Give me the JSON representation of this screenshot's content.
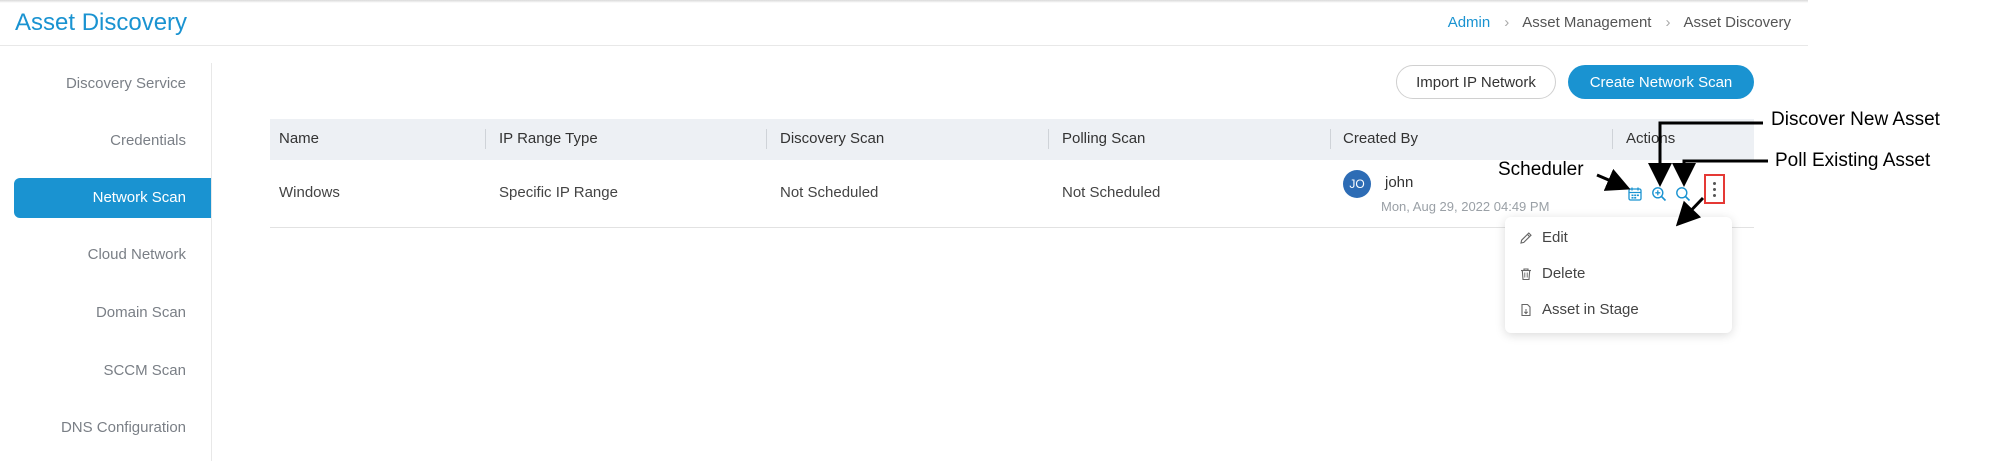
{
  "header": {
    "title": "Asset Discovery",
    "breadcrumb": [
      "Admin",
      "Asset Management",
      "Asset Discovery"
    ]
  },
  "sidebar": {
    "items": [
      {
        "label": "Discovery Service"
      },
      {
        "label": "Credentials"
      },
      {
        "label": "Network Scan"
      },
      {
        "label": "Cloud Network"
      },
      {
        "label": "Domain Scan"
      },
      {
        "label": "SCCM Scan"
      },
      {
        "label": "DNS Configuration"
      }
    ],
    "active": "Network Scan"
  },
  "toolbar": {
    "import_label": "Import IP Network",
    "create_label": "Create Network Scan"
  },
  "table": {
    "columns": [
      "Name",
      "IP Range Type",
      "Discovery Scan",
      "Polling Scan",
      "Created By",
      "Actions"
    ],
    "rows": [
      {
        "name": "Windows",
        "ip_range_type": "Specific IP Range",
        "discovery_scan": "Not Scheduled",
        "polling_scan": "Not Scheduled",
        "avatar_initials": "JO",
        "created_by": "john",
        "created_at": "Mon, Aug 29, 2022 04:49 PM"
      }
    ]
  },
  "row_menu": {
    "items": [
      {
        "label": "Edit",
        "icon": "pencil-icon"
      },
      {
        "label": "Delete",
        "icon": "trash-icon"
      },
      {
        "label": "Asset in Stage",
        "icon": "document-icon"
      }
    ]
  },
  "annotations": {
    "scheduler": "Scheduler",
    "discover_new": "Discover New Asset",
    "poll_existing": "Poll Existing Asset"
  },
  "colors": {
    "accent": "#1a93d1",
    "highlight": "#e53935"
  }
}
